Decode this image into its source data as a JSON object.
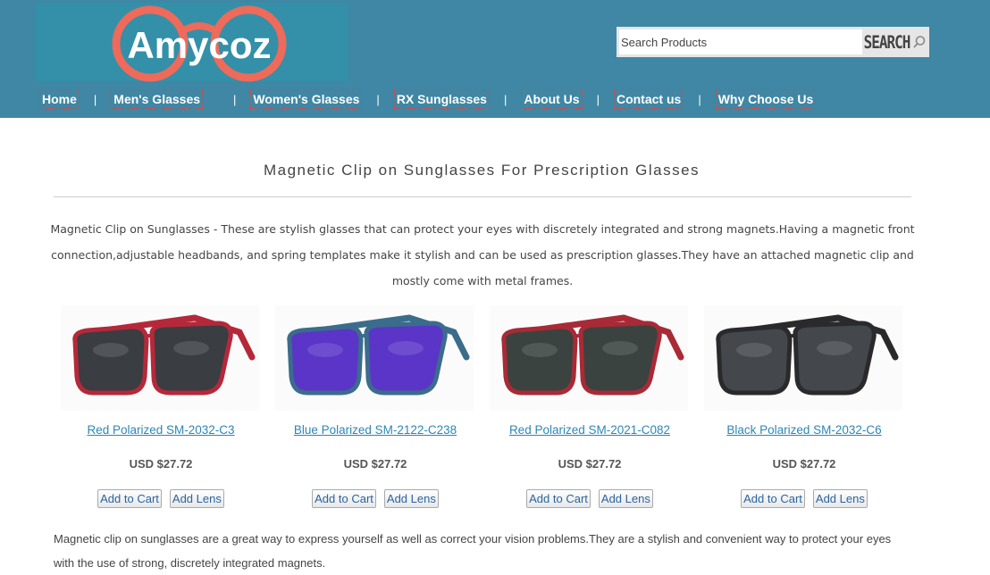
{
  "brand": {
    "logo_text": "Amycoz"
  },
  "search": {
    "placeholder": "Search Products",
    "button_label": "SEARCH"
  },
  "nav": {
    "items": [
      {
        "label": "Home"
      },
      {
        "label": "Men's Glasses"
      },
      {
        "label": "Women's Glasses"
      },
      {
        "label": "RX Sunglasses"
      },
      {
        "label": "About Us"
      },
      {
        "label": "Contact us"
      },
      {
        "label": "Why Choose Us"
      }
    ],
    "separator": "|"
  },
  "page": {
    "title": "Magnetic Clip on Sunglasses For Prescription Glasses",
    "description": "Magnetic Clip on Sunglasses - These are stylish glasses that can protect your eyes with discretely integrated and strong magnets.Having a magnetic front connection,adjustable headbands, and spring templates make it stylish and can be used as prescription glasses.They have an attached magnetic clip and mostly come with metal frames.",
    "footer_text": "Magnetic clip on sunglasses are a great way to express yourself as well as correct your vision problems.They are a stylish and convenient way to protect your eyes with the use of strong, discretely integrated magnets."
  },
  "products": [
    {
      "name": "Red Polarized SM-2032-C3",
      "price": "USD $27.72",
      "frame_color": "#b5283a",
      "lens_color": "#3a3d42",
      "cart_label": "Add to Cart",
      "lens_label": "Add Lens"
    },
    {
      "name": "Blue Polarized SM-2122-C238",
      "price": "USD $27.72",
      "frame_color": "#3b6c8c",
      "lens_color": "#5a35c8",
      "cart_label": "Add to Cart",
      "lens_label": "Add Lens"
    },
    {
      "name": "Red Polarized SM-2021-C082",
      "price": "USD $27.72",
      "frame_color": "#a82a36",
      "lens_color": "#3a4340",
      "cart_label": "Add to Cart",
      "lens_label": "Add Lens"
    },
    {
      "name": "Black Polarized SM-2032-C6",
      "price": "USD $27.72",
      "frame_color": "#2a2a2c",
      "lens_color": "#44474c",
      "cart_label": "Add to Cart",
      "lens_label": "Add Lens"
    }
  ]
}
